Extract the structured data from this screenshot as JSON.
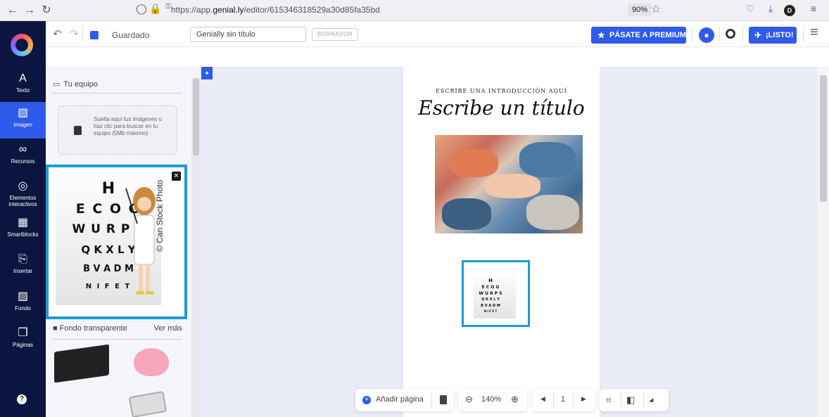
{
  "browser": {
    "url_prefix": "https://app.",
    "url_domain": "genial.ly",
    "url_path": "/editor/615346318529a30d85fa35bd",
    "zoom": "90%"
  },
  "toolbar": {
    "saved_label": "Guardado",
    "title_value": "Genially sin título",
    "draft_badge": "BORRADOR",
    "premium_label": "PÁSATE A PREMIUM",
    "ready_label": "¡LISTO!"
  },
  "sidebar": {
    "items": [
      {
        "icon": "text-icon",
        "glyph": "A",
        "label": "Texto"
      },
      {
        "icon": "image-icon",
        "glyph": "▧",
        "label": "Imagen"
      },
      {
        "icon": "resources-icon",
        "glyph": "∞",
        "label": "Recursos"
      },
      {
        "icon": "interactive-icon",
        "glyph": "◎",
        "label": "Elementos interactivos"
      },
      {
        "icon": "smartblocks-icon",
        "glyph": "▦",
        "label": "Smartblocks"
      },
      {
        "icon": "insert-icon",
        "glyph": "⎘",
        "label": "Insertar"
      },
      {
        "icon": "background-icon",
        "glyph": "▨",
        "label": "Fondo"
      },
      {
        "icon": "pages-icon",
        "glyph": "❐",
        "label": "Páginas"
      }
    ],
    "active_index": 1
  },
  "panel": {
    "team_heading": "Tu equipo",
    "dropzone_text": "Suelta aquí tus imágenes o haz clic para buscar en tu equipo (5Mb máximo)",
    "eye_chart_lines": [
      "H",
      "E C O G",
      "W U R P S",
      "Q K X L Y",
      "B V A D M",
      "N I F E T"
    ],
    "stock_credit": "© Can Stock Photo",
    "transparent_heading": "Fondo transparente",
    "see_more": "Ver más"
  },
  "canvas": {
    "intro_text": "ESCRIBE UNA INTRODUCCIÓN AQUÍ",
    "title_text": "Escribe un título"
  },
  "bottom_bar": {
    "add_page_label": "Añadir página",
    "zoom_value": "140%",
    "page_number": "1"
  },
  "colors": {
    "accent": "#2f5bea",
    "sidebar_bg": "#0b1540",
    "selection": "#1c9bd8"
  }
}
